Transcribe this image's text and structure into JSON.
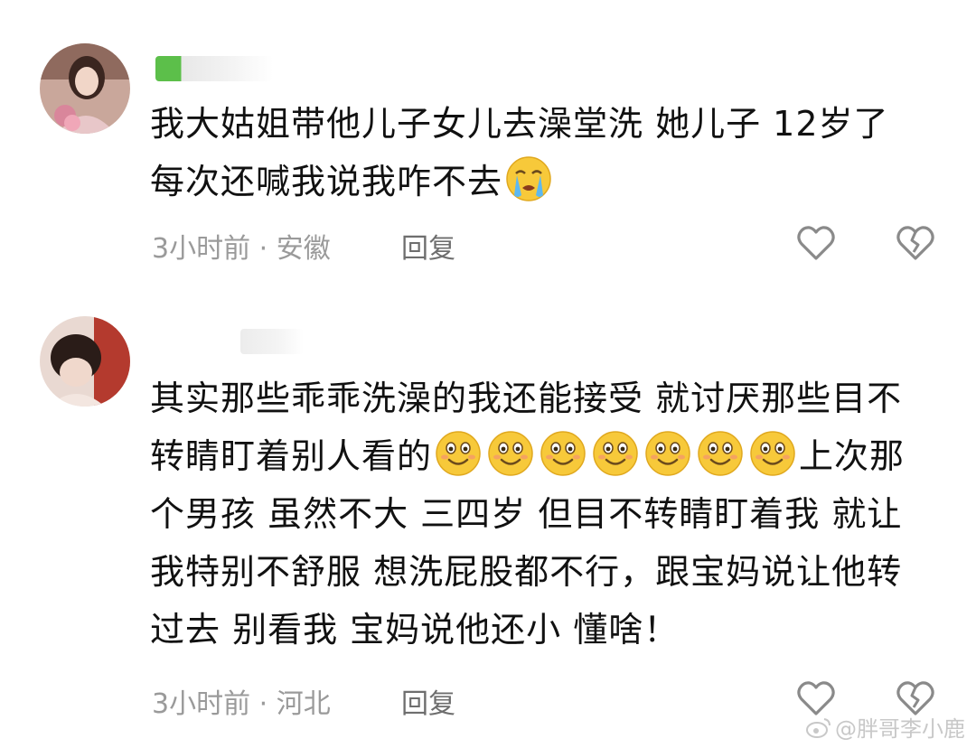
{
  "comments": [
    {
      "text_lines": [
        "我大姑姐带他儿子女儿去澡堂洗 她儿子 12岁了",
        "每次还喊我说我咋不去"
      ],
      "emoji": "crying-emoji",
      "time": "3小时前",
      "location": "安徽",
      "reply_label": "回复"
    },
    {
      "text_lines": [
        "其实那些乖乖洗澡的我还能接受 就讨厌那些目不",
        "转睛盯着别人看的",
        "上次那",
        "个男孩 虽然不大 三四岁 但目不转睛盯着我 就让",
        "我特别不舒服 想洗屁股都不行，跟宝妈说让他转",
        "过去 别看我 宝妈说他还小 懂啥！"
      ],
      "emoji": "smile-emoji",
      "emoji_count": 7,
      "time": "3小时前",
      "location": "河北",
      "reply_label": "回复"
    }
  ],
  "separator": " · ",
  "icons": {
    "like": "heart-outline-icon",
    "dislike": "broken-heart-icon"
  },
  "watermark": "@胖哥李小鹿",
  "colors": {
    "text": "#111111",
    "meta": "#9a9a9a",
    "reply": "#6e6e6e",
    "icon": "#8a8a8a",
    "username_green": "#5cbf4a"
  }
}
